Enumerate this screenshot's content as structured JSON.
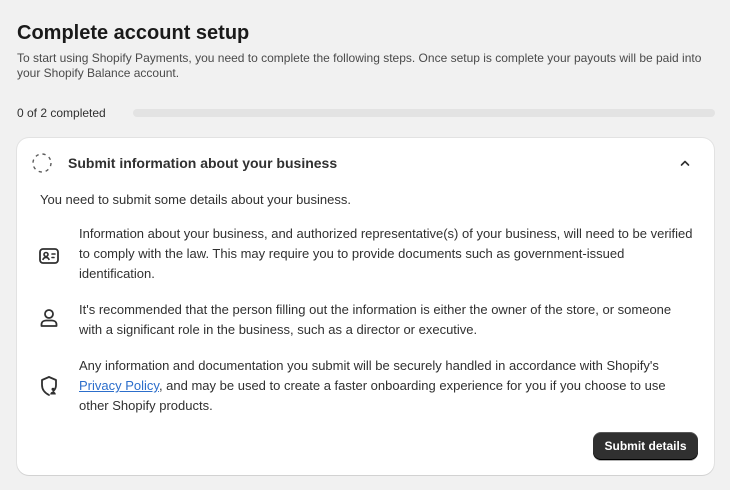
{
  "page": {
    "title": "Complete account setup",
    "description": "To start using Shopify Payments, you need to complete the following steps. Once setup is complete your payouts will be paid into your Shopify Balance account."
  },
  "progress": {
    "label": "0 of 2 completed",
    "completed": 0,
    "total": 2,
    "fraction": 0
  },
  "step": {
    "title": "Submit information about your business",
    "expanded": true,
    "intro": "You need to submit some details about your business.",
    "items": [
      {
        "icon": "id-card-icon",
        "text": "Information about your business, and authorized representative(s) of your business, will need to be verified to comply with the law. This may require you to provide documents such as government-issued identification."
      },
      {
        "icon": "person-icon",
        "text": "It's recommended that the person filling out the information is either the owner of the store, or someone with a significant role in the business, such as a director or executive."
      },
      {
        "icon": "privacy-shield-icon",
        "text_before": "Any information and documentation you submit will be securely handled in accordance with Shopify's ",
        "link_text": "Privacy Policy",
        "text_after": ", and may be used to create a faster onboarding experience for you if you choose to use other Shopify products."
      }
    ],
    "submit_label": "Submit details"
  },
  "colors": {
    "background": "#f1f1f1",
    "card": "#ffffff",
    "primary_button": "#303030",
    "link": "#2c6ecb",
    "progress_track": "#e3e3e3"
  }
}
